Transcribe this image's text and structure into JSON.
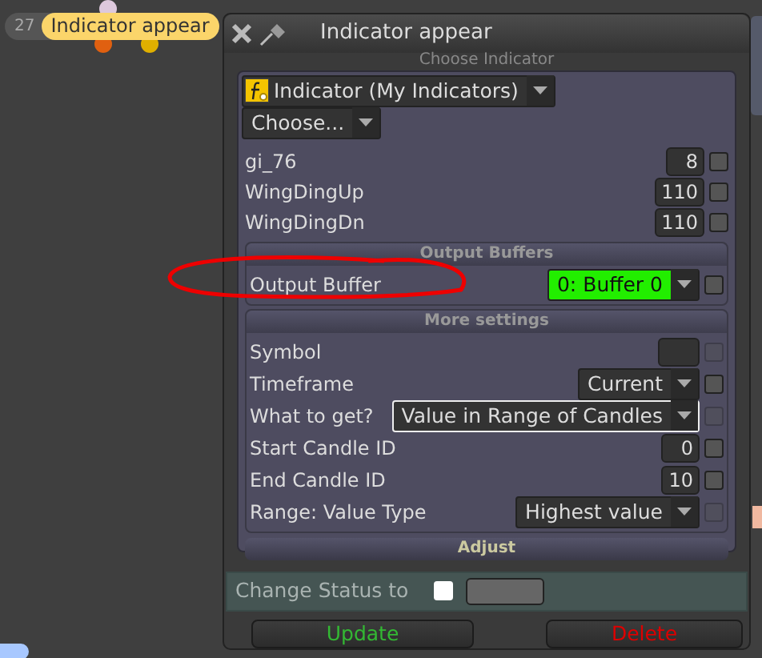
{
  "canvas_nodes": [
    {
      "number": "27",
      "label": "Indicator appear"
    }
  ],
  "dialog": {
    "title": "Indicator appear",
    "choose_header": "Choose Indicator",
    "indicator_select": "Indicator (My Indicators)",
    "choose_select": "Choose...",
    "params": [
      {
        "label": "gi_76",
        "value": "8",
        "checked": false
      },
      {
        "label": "WingDingUp",
        "value": "110",
        "checked": false
      },
      {
        "label": "WingDingDn",
        "value": "110",
        "checked": false
      }
    ],
    "sections": [
      {
        "title": "Output Buffers",
        "rows": [
          {
            "kind": "select",
            "label": "Output Buffer",
            "value": "0: Buffer 0",
            "highlighted": true,
            "focused": false,
            "checkbox_disabled": false,
            "checked": false
          }
        ]
      },
      {
        "title": "More settings",
        "rows": [
          {
            "kind": "text",
            "label": "Symbol",
            "checkbox_disabled": true,
            "checked": false
          },
          {
            "kind": "select",
            "label": "Timeframe",
            "value": "Current",
            "highlighted": false,
            "focused": false,
            "checkbox_disabled": false,
            "checked": false
          },
          {
            "kind": "select",
            "label": "What to get?",
            "value": "Value in Range of Candles",
            "highlighted": false,
            "focused": true,
            "checkbox_disabled": true,
            "checked": false
          },
          {
            "kind": "number",
            "label": "Start Candle ID",
            "value": "0",
            "checkbox_disabled": false,
            "checked": false
          },
          {
            "kind": "number",
            "label": "End Candle ID",
            "value": "10",
            "checkbox_disabled": false,
            "checked": false
          },
          {
            "kind": "select",
            "label": "Range: Value Type",
            "value": "Highest value",
            "highlighted": false,
            "focused": false,
            "checkbox_disabled": true,
            "checked": false
          }
        ]
      }
    ],
    "adjust_label": "Adjust",
    "status": {
      "label": "Change Status to",
      "checked": false
    },
    "buttons": [
      {
        "label": "Update",
        "kind": "update"
      },
      {
        "label": "Delete",
        "kind": "delete"
      }
    ]
  }
}
